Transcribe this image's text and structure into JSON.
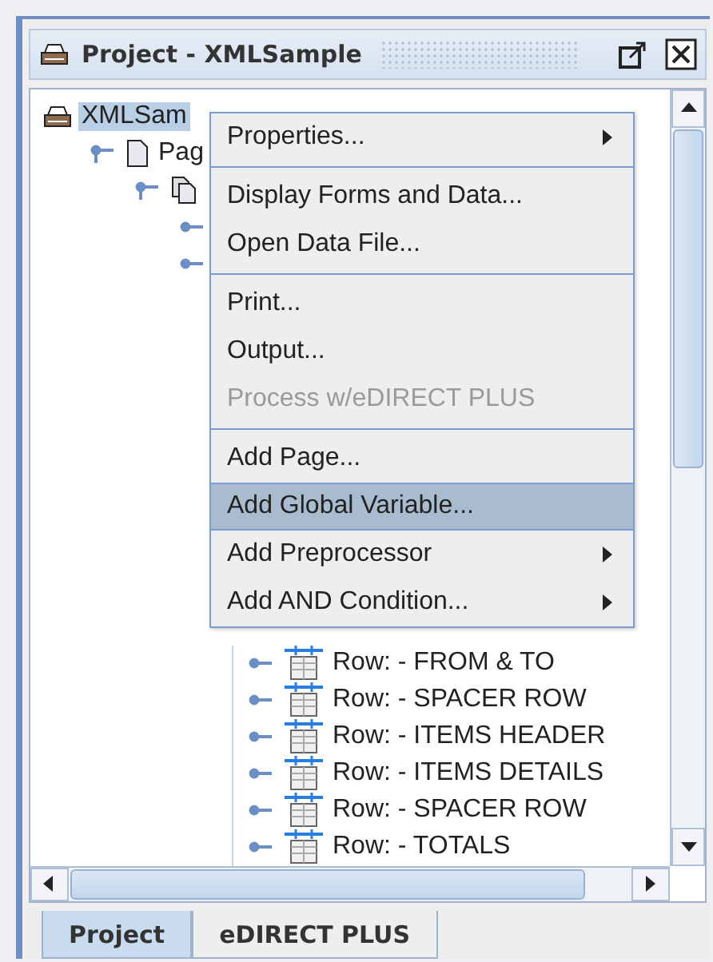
{
  "window": {
    "title": "Project - XMLSample"
  },
  "tree": {
    "label": "XMLSam",
    "selected": true,
    "children": [
      {
        "label": "Pag",
        "expanded": true,
        "children": [
          {
            "expanded": true,
            "children": [
              {
                "expanded": false
              },
              {
                "expanded": false
              }
            ]
          }
        ]
      }
    ]
  },
  "rows": [
    {
      "label": "Row:  - FROM & TO"
    },
    {
      "label": "Row:  - SPACER ROW"
    },
    {
      "label": "Row:  - ITEMS HEADER"
    },
    {
      "label": "Row:  - ITEMS DETAILS"
    },
    {
      "label": "Row:  - SPACER ROW"
    },
    {
      "label": "Row:  - TOTALS"
    }
  ],
  "context_menu": {
    "groups": [
      [
        {
          "label": "Properties...",
          "submenu": true,
          "disabled": false,
          "selected": false
        }
      ],
      [
        {
          "label": "Display Forms and Data...",
          "submenu": false,
          "disabled": false,
          "selected": false
        },
        {
          "label": "Open Data File...",
          "submenu": false,
          "disabled": false,
          "selected": false
        }
      ],
      [
        {
          "label": "Print...",
          "submenu": false,
          "disabled": false,
          "selected": false
        },
        {
          "label": "Output...",
          "submenu": false,
          "disabled": false,
          "selected": false
        },
        {
          "label": "Process w/eDIRECT PLUS",
          "submenu": false,
          "disabled": true,
          "selected": false
        }
      ],
      [
        {
          "label": "Add Page...",
          "submenu": false,
          "disabled": false,
          "selected": false
        },
        {
          "label": "Add Global Variable...",
          "submenu": false,
          "disabled": false,
          "selected": true
        },
        {
          "label": "Add Preprocessor",
          "submenu": true,
          "disabled": false,
          "selected": false
        },
        {
          "label": "Add AND Condition...",
          "submenu": true,
          "disabled": false,
          "selected": false
        }
      ]
    ]
  },
  "tabs": [
    {
      "label": "Project",
      "selected": true
    },
    {
      "label": "eDIRECT PLUS",
      "selected": false
    }
  ]
}
